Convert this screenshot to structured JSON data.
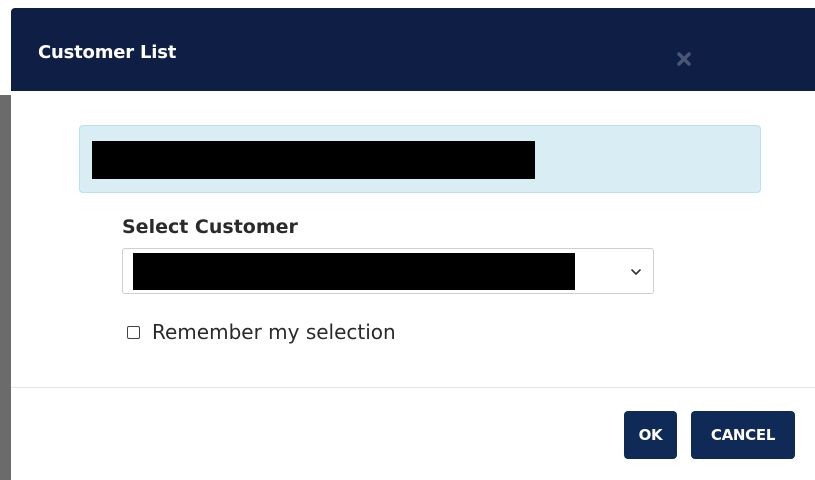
{
  "dialog": {
    "title": "Customer List",
    "close_icon": "close-icon",
    "alert": {
      "text": ""
    },
    "customer_field": {
      "label": "Select Customer",
      "selected_value": "",
      "chevron_icon": "chevron-down-icon"
    },
    "remember": {
      "label": "Remember my selection",
      "checked": false
    },
    "buttons": {
      "ok_label": "OK",
      "cancel_label": "CANCEL"
    }
  },
  "colors": {
    "header_bg": "#0f1e45",
    "button_bg": "#0f2a56",
    "alert_bg": "#d9edf5",
    "alert_border": "#bde0ec",
    "backdrop": "#6b6b6b",
    "redaction": "#000000"
  }
}
